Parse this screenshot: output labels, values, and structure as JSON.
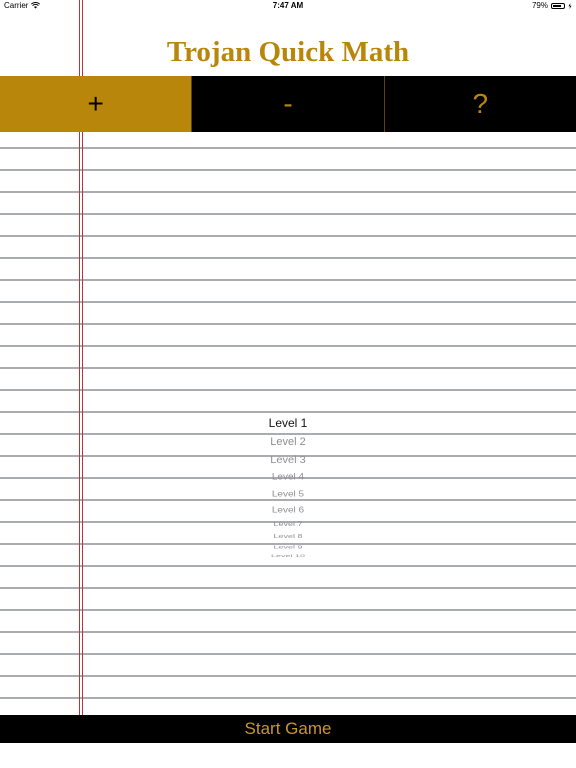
{
  "status_bar": {
    "carrier": "Carrier",
    "time": "7:47 AM",
    "battery": "79%",
    "battery_level": 0.79,
    "wifi_icon": "wifi-icon",
    "battery_icon": "battery-icon"
  },
  "app": {
    "title": "Trojan Quick Math"
  },
  "tabs": [
    {
      "label": "+",
      "active": true
    },
    {
      "label": "-",
      "active": false
    },
    {
      "label": "?",
      "active": false
    }
  ],
  "picker": {
    "options": [
      "Level 1",
      "Level 2",
      "Level 3",
      "Level 4",
      "Level 5",
      "Level 6",
      "Level 7",
      "Level 8",
      "Level 9",
      "Level 10"
    ],
    "selected": "Level 1"
  },
  "start_button": {
    "label": "Start Game"
  },
  "colors": {
    "accent": "#b8860b",
    "bar_background": "#000000",
    "margin_line": "#c0313a",
    "rule_line": "#a9acb0"
  }
}
